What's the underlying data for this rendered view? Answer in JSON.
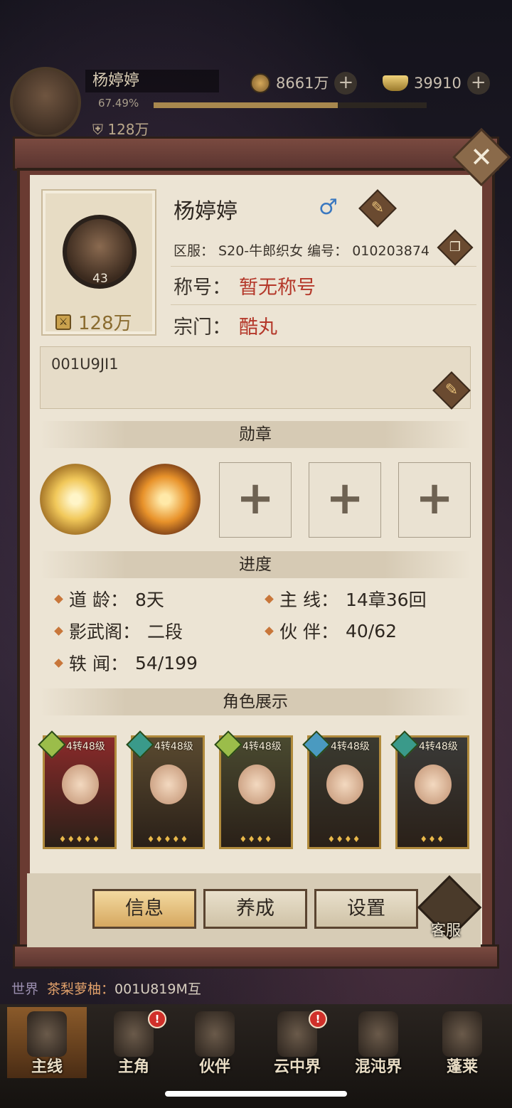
{
  "hud": {
    "player_name": "杨婷婷",
    "level": "43",
    "exp_percent_text": "67.49%",
    "exp_fraction": 0.6749,
    "power": "128万",
    "coins": "8661万",
    "ingots": "39910",
    "plus_symbol": "+"
  },
  "profile": {
    "name": "杨婷婷",
    "gender_symbol": "♂",
    "server_line": "区服：  S20-牛郎织女 编号：  010203874",
    "title_label": "称号：",
    "title_value": "暂无称号",
    "sect_label": "宗门：",
    "sect_value": "酷丸",
    "portrait_level": "43",
    "portrait_power": "128万",
    "signature": "001U9JI1",
    "edit_symbol": "✎",
    "copy_symbol": "❐"
  },
  "medals": {
    "header": "勋章",
    "slot_symbol": "+"
  },
  "progress": {
    "header": "进度",
    "items": [
      {
        "label": "道    龄：",
        "value": "8天"
      },
      {
        "label": "主    线：",
        "value": "14章36回"
      },
      {
        "label": "影武阁：",
        "value": "二段"
      },
      {
        "label": "伙    伴：",
        "value": "40/62"
      },
      {
        "label": "轶    闻：",
        "value": "54/199"
      }
    ]
  },
  "showcase": {
    "header": "角色展示",
    "cards": [
      {
        "level": "4转48级",
        "stars": "♦♦♦♦♦",
        "bg": "#8a2a2a",
        "elem": "#9bbd4a"
      },
      {
        "level": "4转48级",
        "stars": "♦♦♦♦♦",
        "bg": "#5a4a30",
        "elem": "#3a9a8a"
      },
      {
        "level": "4转48级",
        "stars": "♦♦♦♦",
        "bg": "#4a4a30",
        "elem": "#9bbd4a"
      },
      {
        "level": "4转48级",
        "stars": "♦♦♦♦",
        "bg": "#3a3a30",
        "elem": "#4a9ac0"
      },
      {
        "level": "4转48级",
        "stars": "♦♦♦",
        "bg": "#3a3a38",
        "elem": "#3a9a8a"
      }
    ]
  },
  "tabs": {
    "info": "信息",
    "develop": "养成",
    "settings": "设置",
    "service": "客服"
  },
  "close_symbol": "✕",
  "chat": {
    "tag": "世界",
    "sender": "茶梨萝柚：",
    "message": "001U819M互"
  },
  "nav": {
    "items": [
      "主线",
      "主角",
      "伙伴",
      "云中界",
      "混沌界",
      "蓬莱"
    ],
    "badge": "!"
  }
}
